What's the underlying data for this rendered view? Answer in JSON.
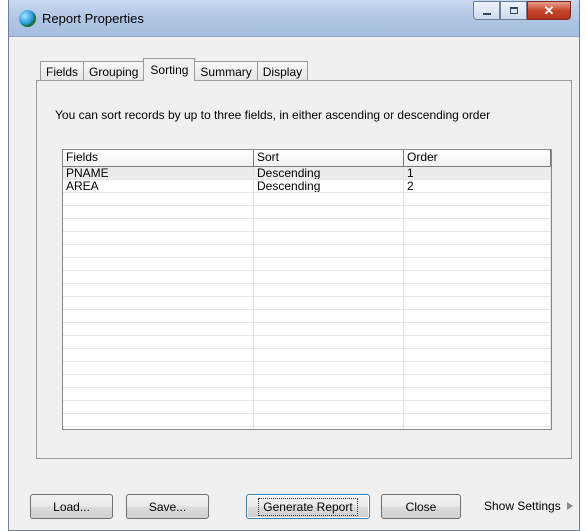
{
  "window": {
    "title": "Report Properties"
  },
  "tabs": [
    {
      "label": "Fields",
      "active": false
    },
    {
      "label": "Grouping",
      "active": false
    },
    {
      "label": "Sorting",
      "active": true
    },
    {
      "label": "Summary",
      "active": false
    },
    {
      "label": "Display",
      "active": false
    }
  ],
  "sorting": {
    "instructions": "You can sort records by up to three fields, in either ascending or descending order",
    "columns": [
      "Fields",
      "Sort",
      "Order"
    ],
    "rows": [
      {
        "field": "PNAME",
        "sort": "Descending",
        "order": "1"
      },
      {
        "field": "AREA",
        "sort": "Descending",
        "order": "2"
      }
    ]
  },
  "buttons": {
    "load": "Load...",
    "save": "Save...",
    "generate": "Generate Report",
    "close": "Close",
    "show_settings": "Show Settings"
  },
  "icons": {
    "app": "globe-icon",
    "show_settings": "triangle-right-icon"
  }
}
